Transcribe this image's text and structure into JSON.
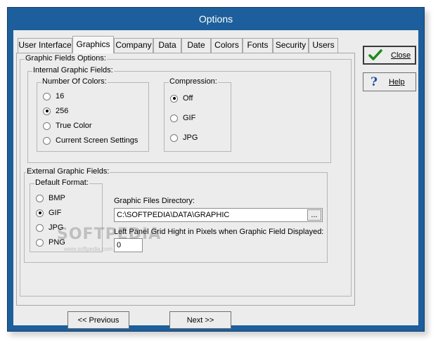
{
  "window": {
    "title": "Options"
  },
  "tabs": [
    {
      "label": "User Interface",
      "active": false
    },
    {
      "label": "Graphics",
      "active": true
    },
    {
      "label": "Company",
      "active": false
    },
    {
      "label": "Data",
      "active": false
    },
    {
      "label": "Date",
      "active": false
    },
    {
      "label": "Colors",
      "active": false
    },
    {
      "label": "Fonts",
      "active": false
    },
    {
      "label": "Security",
      "active": false
    },
    {
      "label": "Users",
      "active": false
    }
  ],
  "graphic_fields": {
    "label": "Graphic Fields Options:",
    "internal": {
      "label": "Internal Graphic Fields:",
      "colors": {
        "label": "Number Of Colors:",
        "options": [
          {
            "label": "16",
            "selected": false
          },
          {
            "label": "256",
            "selected": true
          },
          {
            "label": "True Color",
            "selected": false
          },
          {
            "label": "Current Screen Settings",
            "selected": false
          }
        ]
      },
      "compression": {
        "label": "Compression:",
        "options": [
          {
            "label": "Off",
            "selected": true
          },
          {
            "label": "GIF",
            "selected": false
          },
          {
            "label": "JPG",
            "selected": false
          }
        ]
      }
    },
    "external": {
      "label": "External Graphic Fields:",
      "default_format": {
        "label": "Default Format:",
        "options": [
          {
            "label": "BMP",
            "selected": false
          },
          {
            "label": "GIF",
            "selected": true
          },
          {
            "label": "JPG",
            "selected": false
          },
          {
            "label": "PNG",
            "selected": false
          }
        ]
      },
      "directory": {
        "label": "Graphic Files Directory:",
        "value": "C:\\SOFTPEDIA\\DATA\\GRAPHIC",
        "browse_label": "..."
      },
      "grid_height": {
        "label": "Left Panel Grid Hight in Pixels when Graphic Field Displayed:",
        "value": "0"
      }
    }
  },
  "buttons": {
    "close": "Close",
    "help": "Help",
    "previous": "<< Previous",
    "next": "Next >>"
  },
  "watermark": {
    "text": "SOFTPEDIA",
    "url": "www.softpedia.com"
  }
}
